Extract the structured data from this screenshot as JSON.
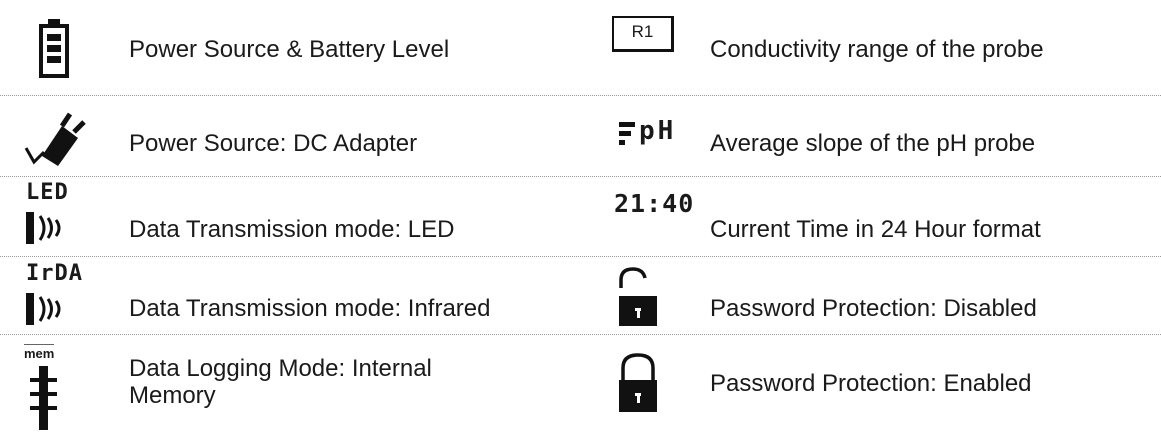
{
  "legend": {
    "left": [
      {
        "icon": "battery-icon",
        "label": "Power Source & Battery Level"
      },
      {
        "icon": "dc-adapter-plug-icon",
        "label": "Power Source: DC Adapter"
      },
      {
        "icon": "led-transmission-icon",
        "icon_text": "LED",
        "label": "Data Transmission mode: LED"
      },
      {
        "icon": "infrared-transmission-icon",
        "icon_text": "IrDA",
        "label": "Data Transmission mode: Infrared"
      },
      {
        "icon": "internal-memory-icon",
        "icon_text": "mem",
        "label": "Data Logging Mode: Internal Memory"
      }
    ],
    "right": [
      {
        "icon": "range-box-icon",
        "icon_text": "R1",
        "label": "Conductivity range of the probe"
      },
      {
        "icon": "ph-slope-icon",
        "icon_text": "pH",
        "label": "Average slope of the pH probe"
      },
      {
        "icon": "clock-digits-icon",
        "icon_text": "21:40",
        "label": "Current Time in 24 Hour format"
      },
      {
        "icon": "unlocked-padlock-icon",
        "label": "Password Protection: Disabled"
      },
      {
        "icon": "locked-padlock-icon",
        "label": "Password Protection: Enabled"
      }
    ]
  }
}
